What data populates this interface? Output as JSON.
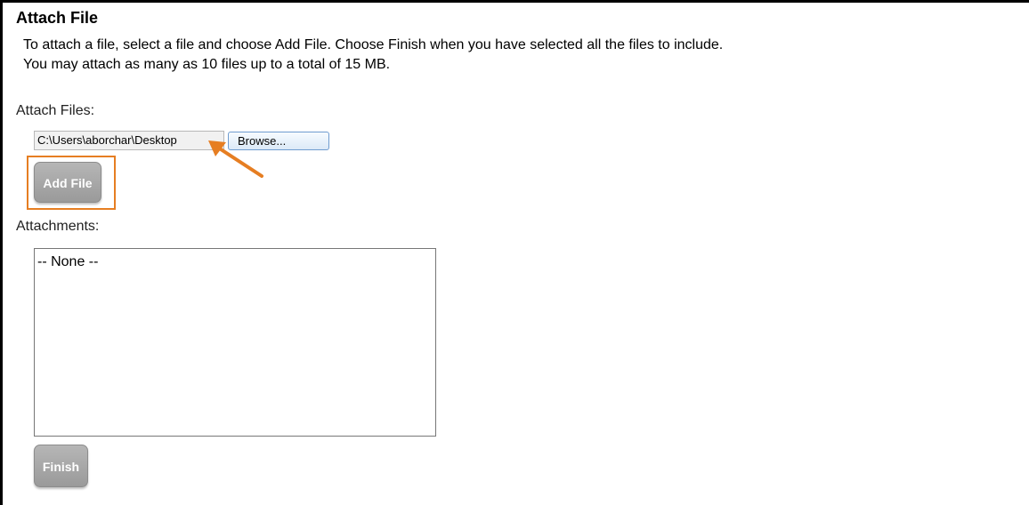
{
  "header": {
    "title": "Attach File"
  },
  "instructions": {
    "line1": "To attach a file, select a file and choose Add File. Choose Finish when you have selected all the files to include.",
    "line2": "You may attach as many as 10 files up to a total of 15 MB."
  },
  "attach_files": {
    "label": "Attach Files:",
    "file_path_value": "C:\\Users\\aborchar\\Desktop",
    "browse_label": "Browse...",
    "add_file_label": "Add File"
  },
  "attachments": {
    "label": "Attachments:",
    "items": [
      "-- None --"
    ]
  },
  "finish_label": "Finish",
  "colors": {
    "highlight": "#e67e22",
    "button_gray": "#a8a8a8",
    "browse_border": "#6f9ccf"
  },
  "icons": {
    "annotation_arrow": "arrow-icon"
  }
}
